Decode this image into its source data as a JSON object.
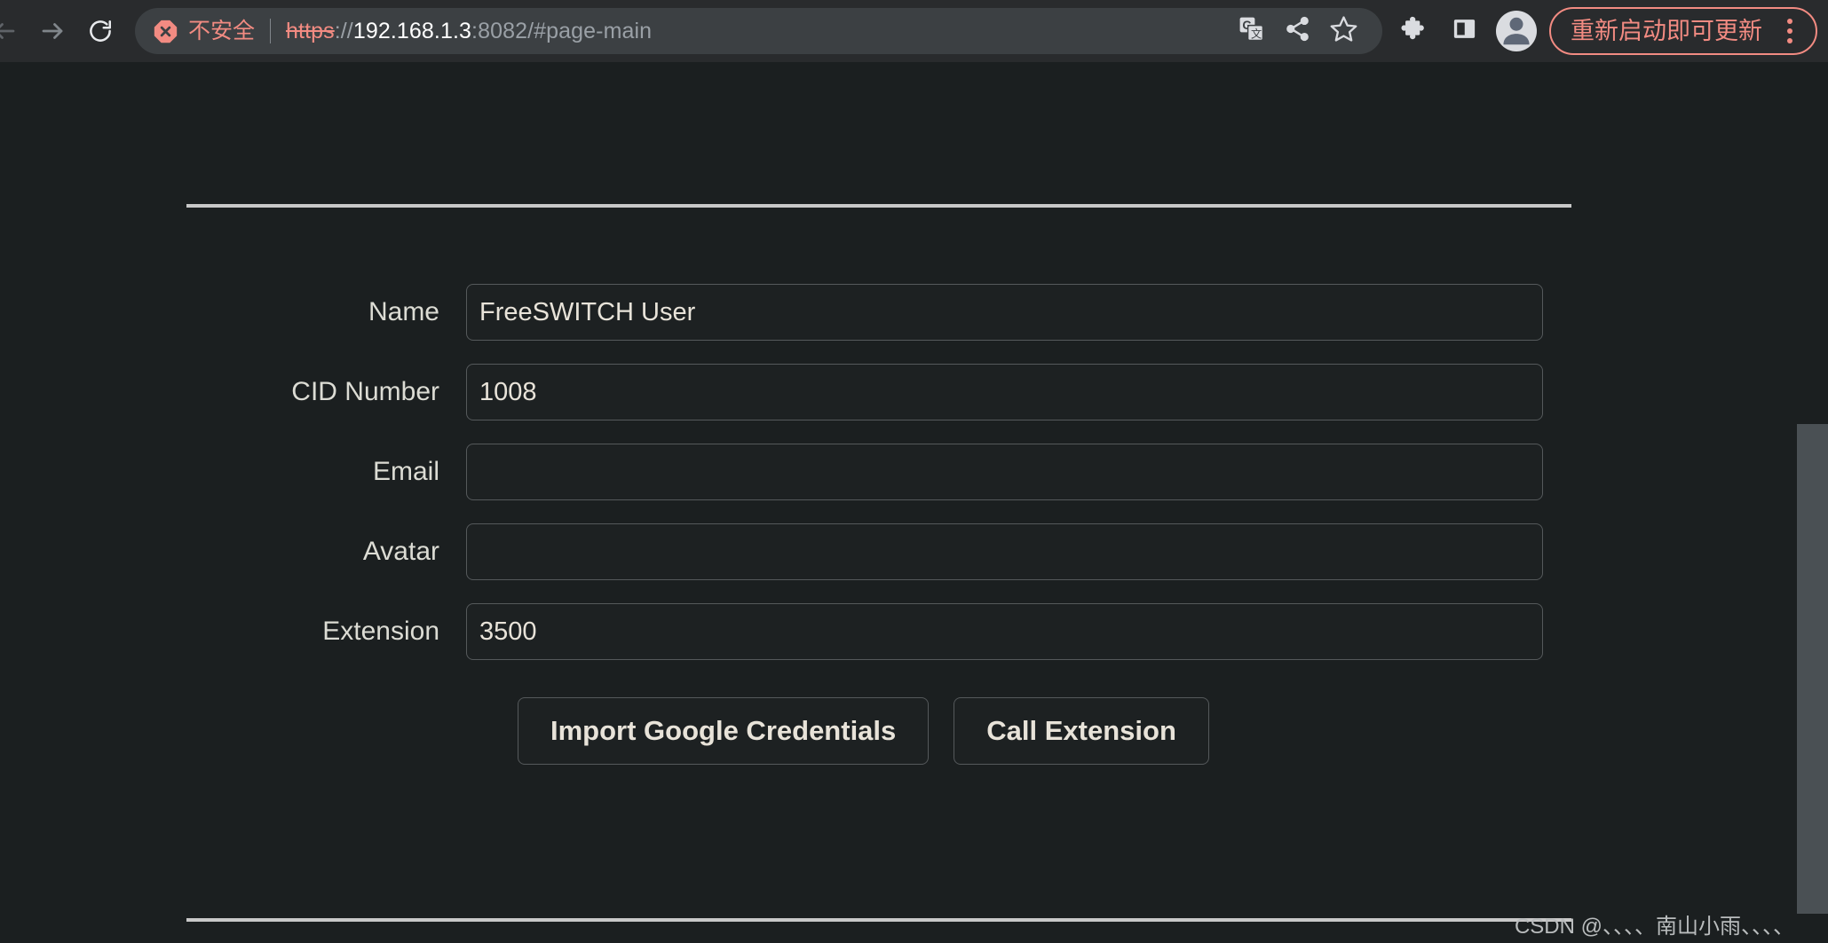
{
  "browser": {
    "nav": {
      "back_icon": "arrow-left-icon",
      "forward_icon": "arrow-right-icon",
      "reload_icon": "reload-icon"
    },
    "omnibox": {
      "security_badge_icon": "not-secure-octagon-icon",
      "security_label": "不安全",
      "url_scheme": "https",
      "url_separator": "://",
      "url_host": "192.168.1.3",
      "url_port": ":8082",
      "url_path": "/#page-main",
      "full_url": "https://192.168.1.3:8082/#page-main",
      "translate_icon": "google-translate-icon",
      "share_icon": "share-icon",
      "bookmark_icon": "star-bookmark-icon"
    },
    "toolbar": {
      "extensions_icon": "puzzle-extensions-icon",
      "side_panel_icon": "side-panel-icon",
      "profile_icon": "profile-avatar-icon",
      "update_label": "重新启动即可更新",
      "menu_icon": "kebab-menu-icon"
    }
  },
  "page": {
    "form": {
      "fields": [
        {
          "label": "Name",
          "value": "FreeSWITCH User",
          "placeholder": ""
        },
        {
          "label": "CID Number",
          "value": "1008",
          "placeholder": ""
        },
        {
          "label": "Email",
          "value": "",
          "placeholder": ""
        },
        {
          "label": "Avatar",
          "value": "",
          "placeholder": ""
        },
        {
          "label": "Extension",
          "value": "3500",
          "placeholder": ""
        }
      ],
      "buttons": [
        {
          "label": "Import Google Credentials"
        },
        {
          "label": "Call Extension"
        }
      ]
    },
    "watermark": "CSDN @、、、、南山小雨、、、、"
  },
  "colors": {
    "page_background": "#1b1f20",
    "chrome_background": "#292b2d",
    "omnibox_background": "#3c4043",
    "warning_accent": "#f28b82",
    "text_primary": "#e8e3d9",
    "input_border": "#55595b",
    "scrollbar_thumb": "#4a5054",
    "rule": "#c8c8c8"
  }
}
